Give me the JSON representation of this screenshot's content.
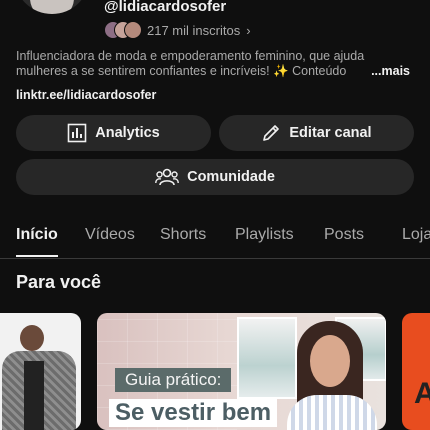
{
  "channel": {
    "handle": "@lidiacardosofer",
    "subscribers": "217 mil inscritos",
    "description": "Influenciadora de moda e empoderamento feminino, que ajuda mulheres a se sentirem confiantes e incríveis! ✨ Conteúdo",
    "more_label": "...mais",
    "link": "linktr.ee/lidiacardosofer"
  },
  "buttons": {
    "analytics": "Analytics",
    "edit": "Editar canal",
    "community": "Comunidade"
  },
  "tabs": [
    {
      "label": "Início",
      "active": true
    },
    {
      "label": "Vídeos"
    },
    {
      "label": "Shorts"
    },
    {
      "label": "Playlists"
    },
    {
      "label": "Posts"
    },
    {
      "label": "Loja"
    }
  ],
  "section": {
    "title": "Para você"
  },
  "cards": {
    "card2_label": "Guia prático:",
    "card2_title": "Se vestir bem",
    "card3_text": "A"
  },
  "colors": {
    "background": "#0f0f0f",
    "button_bg": "#272727",
    "text_primary": "#f1f1f1",
    "text_secondary": "#aaaaaa"
  },
  "icons": [
    "chevron-right-icon",
    "analytics-icon",
    "pencil-icon",
    "community-icon"
  ]
}
